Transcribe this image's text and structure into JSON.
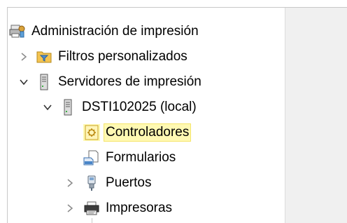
{
  "tree": {
    "root": {
      "label": "Administración de impresión",
      "icon": "print-management-icon"
    },
    "custom_filters": {
      "label": "Filtros personalizados",
      "icon": "folder-filter-icon",
      "expander": "collapsed"
    },
    "print_servers": {
      "label": "Servidores de impresión",
      "icon": "server-icon",
      "expander": "expanded"
    },
    "server": {
      "label": "DSTI102025 (local)",
      "icon": "server-icon",
      "expander": "expanded"
    },
    "children": [
      {
        "key": "drivers",
        "label": "Controladores",
        "icon": "drivers-icon",
        "selected": true,
        "expander": "none"
      },
      {
        "key": "forms",
        "label": "Formularios",
        "icon": "forms-icon",
        "selected": false,
        "expander": "none"
      },
      {
        "key": "ports",
        "label": "Puertos",
        "icon": "ports-icon",
        "selected": false,
        "expander": "collapsed"
      },
      {
        "key": "printers",
        "label": "Impresoras",
        "icon": "printer-icon",
        "selected": false,
        "expander": "collapsed"
      }
    ]
  },
  "colors": {
    "selection_bg": "#fff9b3",
    "selection_border": "#f5e56a",
    "chevron": "#7a7a7a",
    "right_pane_bg": "#f0f0f0"
  }
}
